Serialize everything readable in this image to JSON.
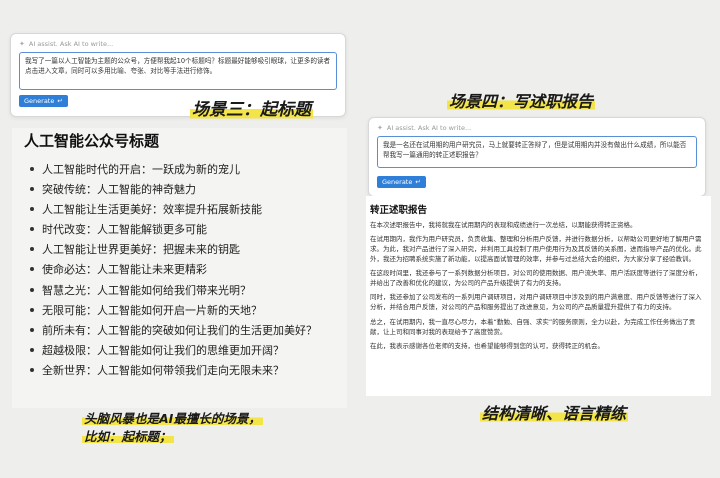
{
  "left_ai": {
    "placeholder": "AI assist. Ask AI to write...",
    "prompt": "我写了一篇以人工智能为主题的公众号，方便帮我起10个标题吗？标题最好能够吸引眼球，让更多的读者点击进入文章，同时可以多用比喻、夸张、对比等手法进行修饰。",
    "generate_label": "Generate"
  },
  "left_list": {
    "title": "人工智能公众号标题",
    "items": [
      "人工智能时代的开启：一跃成为新的宠儿",
      "突破传统：人工智能的神奇魅力",
      "人工智能让生活更美好：效率提升拓展新技能",
      "时代改变：人工智能解锁更多可能",
      "人工智能让世界更美好：把握未来的钥匙",
      "使命必达：人工智能让未来更精彩",
      "智慧之光：人工智能如何给我们带来光明？",
      "无限可能：人工智能如何开启一片新的天地？",
      "前所未有：人工智能的突破如何让我们的生活更加美好？",
      "超越极限：人工智能如何让我们的思维更加开阔？",
      "全新世界：人工智能如何带领我们走向无限未来？"
    ]
  },
  "right_ai": {
    "placeholder": "AI assist. Ask AI to write...",
    "prompt": "我是一名还在试用期的用户研究员，马上就要转正答辩了，但是试用期内并没有做出什么成绩，所以能否帮我写一篇通用的转正述职报告？",
    "generate_label": "Generate"
  },
  "right_report": {
    "title": "转正述职报告",
    "paragraphs": [
      "在本次述职报告中，我将就我在试用期内的表现和成绩进行一次总结，以期能获得转正资格。",
      "在试用期内，我作为用户研究员，负责收集、整理和分析用户反馈，并进行数据分析，以帮助公司更好地了解用户需求。为此，我对产品进行了深入研究，并利用工具控制了用户使用行为及其反馈的关系图，进而指导产品的优化。此外，我还为招聘系统实施了新功能，以提高面试管理的效率，并参与过总结大会的组织，为大家分享了经验教训。",
      "在这段时间里，我还参与了一系列数据分析项目，对公司的使用数据、用户流失率、用户活跃度等进行了深度分析，并给出了改善和优化的建议，为公司的产品升级提供了有力的支持。",
      "同时，我还参加了公司发布的一系列用户调研项目，对用户调研项目中涉及到的用户满意度、用户反馈等进行了深入分析，并结合用户反馈，对公司的产品和服务提出了改进意见，为公司的产品质量提升提供了有力的支持。",
      "总之，在试用期内，我一直尽心尽力，本着“勤勉、自强、求实”的服务原则，全力以赴，为完成工作任务做出了贡献，让上司和同事对我的表现给予了高度赞赏。",
      "在此，我表示感谢各位老师的支持，也希望能够得到您的认可，获得转正的机会。"
    ]
  },
  "annotations": {
    "scene3": "场景三：起标题",
    "scene4": "场景四：写述职报告",
    "structure": "结构清晰、语言精练",
    "brainstorm_line1": "头脑风暴也是AI最擅长的场景，",
    "brainstorm_line2": "比如：起标题；"
  },
  "colors": {
    "accent": "#2f7fd9",
    "highlight": "#f3e44a"
  }
}
